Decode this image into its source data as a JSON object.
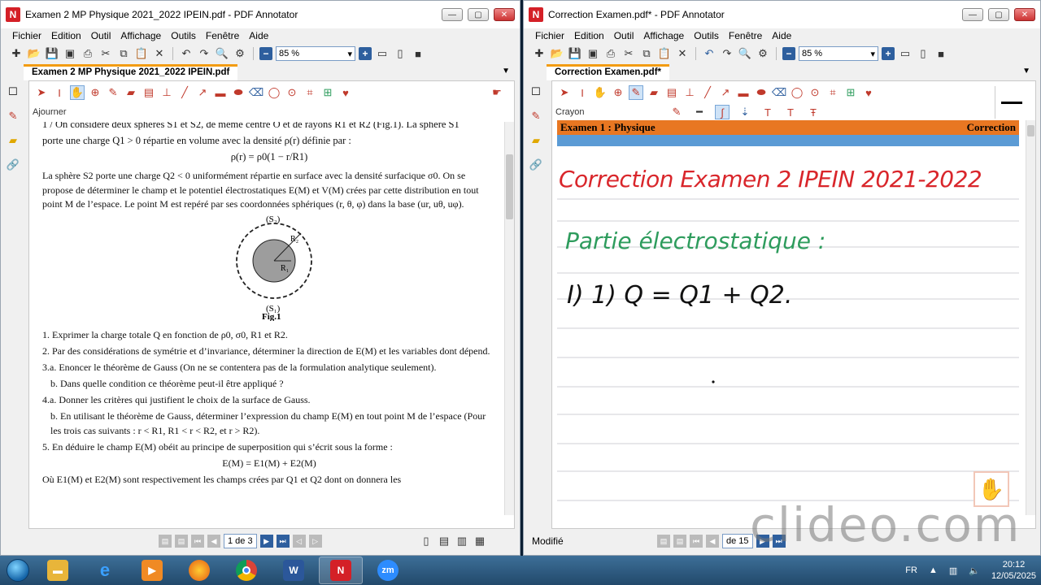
{
  "left_window": {
    "title": "Examen 2 MP Physique 2021_2022 IPEIN.pdf - PDF Annotator",
    "menu": [
      "Fichier",
      "Edition",
      "Outil",
      "Affichage",
      "Outils",
      "Fenêtre",
      "Aide"
    ],
    "zoom": "85 %",
    "tab": "Examen 2 MP Physique 2021_2022 IPEIN.pdf",
    "tool_name": "Ajourner",
    "page_indicator": "1 de 3",
    "document": {
      "line1": "1 / On considère deux sphères S1 et S2, de même centre O et de rayons R1 et R2 (Fig.1). La sphère S1",
      "line2": "porte une charge Q1 > 0 répartie en volume avec la densité ρ(r) définie par :",
      "formula": "ρ(r) = ρ0(1 − r/R1)",
      "para2": "La sphère S2 porte une charge Q2 < 0 uniformément répartie en surface avec la densité surfacique σ0. On se propose de déterminer le champ et le potentiel électrostatiques E(M) et V(M) crées par cette distribution en tout point M de l’espace. Le point M est repéré par ses coordonnées sphériques (r, θ, φ) dans la base (ur, uθ, uφ).",
      "fig_labels": {
        "s2": "(S₂)",
        "s1": "(S₁)",
        "r2": "R₂",
        "r1": "R₁",
        "caption": "Fig.1"
      },
      "questions": [
        "1. Exprimer la charge totale Q en fonction de ρ0, σ0, R1 et R2.",
        "2. Par des considérations de symétrie et d’invariance, déterminer la direction de E(M) et les variables dont dépend.",
        "3.a. Enoncer le théorème de Gauss (On ne se contentera pas de la formulation analytique seulement).",
        "b. Dans quelle condition ce théorème peut-il être appliqué ?",
        "4.a. Donner les critères qui justifient le choix de la surface de Gauss.",
        "b. En utilisant le théorème de Gauss, déterminer l’expression du champ E(M) en tout point M de l’espace (Pour les trois cas suivants : r < R1, R1 < r < R2, et r > R2).",
        "5. En déduire le champ E(M) obéit au principe de superposition qui s’écrit sous la forme :"
      ],
      "superposition": "E(M) = E1(M) + E2(M)",
      "last_line": "Où E1(M) et E2(M) sont respectivement les champs crées par Q1 et Q2 dont on donnera les"
    }
  },
  "right_window": {
    "title": "Correction Examen.pdf* - PDF Annotator",
    "menu": [
      "Fichier",
      "Edition",
      "Outil",
      "Affichage",
      "Outils",
      "Fenêtre",
      "Aide"
    ],
    "zoom": "85 %",
    "tab": "Correction Examen.pdf*",
    "tool_name": "Crayon",
    "header_left": "Examen 1 : Physique",
    "header_right": "Correction",
    "handwritten": {
      "title": "Correction Examen 2 IPEIN 2021-2022",
      "section": "Partie électrostatique :",
      "equation": "I) 1) Q = Q1 + Q2."
    },
    "status": "Modifié",
    "page_indicator": "de 15"
  },
  "taskbar": {
    "lang": "FR",
    "time": "20:12",
    "date": "12/05/2025",
    "apps": [
      "explorer",
      "internet-explorer",
      "media-player",
      "firefox",
      "chrome",
      "word",
      "pdf-annotator",
      "zoom"
    ]
  },
  "watermark": "clideo.com",
  "colors": {
    "accent_orange": "#e87722",
    "header_blue": "#5b9bd5",
    "ink_red": "#d9262b",
    "ink_green": "#2e9c5d",
    "ink_black": "#111111",
    "taskbar": "#2c5a80"
  }
}
